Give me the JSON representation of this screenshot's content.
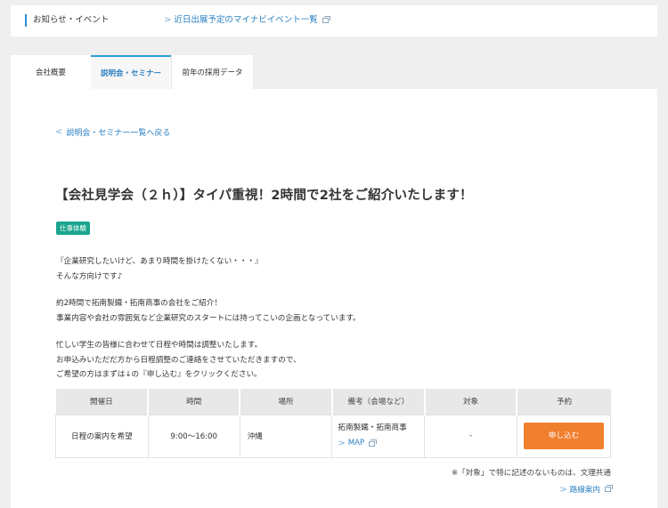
{
  "notice": {
    "label": "お知らせ・イベント",
    "link": "近日出展予定のマイナビイベント一覧"
  },
  "tabs": [
    "会社概要",
    "説明会・セミナー",
    "前年の採用データ"
  ],
  "back_link": "説明会・セミナー一覧へ戻る",
  "title": "【会社見学会（２ｈ）】タイパ重視！2時間で2社をご紹介いたします！",
  "badge": "仕事体験",
  "description": [
    "『企業研究したいけど、あまり時間を掛けたくない・・・』",
    "そんな方向けです♪",
    "約2時間で拓南製鐵・拓南商事の会社をご紹介！",
    "事業内容や会社の雰囲気など企業研究のスタートには持ってこいの企画となっています。",
    "忙しい学生の皆様に合わせて日程や時間は調整いたします。",
    "お申込みいただだ方から日程調整のご連絡をさせていただきますので、",
    "ご希望の方はまずは↓の『申し込む』をクリックください。"
  ],
  "table": {
    "headers": [
      "開催日",
      "時間",
      "場所",
      "備考（会場など）",
      "対象",
      "予約"
    ],
    "row": {
      "date": "日程の案内を希望",
      "time": "9:00〜16:00",
      "place": "沖縄",
      "note": "拓南製鐵・拓南商事",
      "map": "MAP",
      "target": "-",
      "apply": "申し込む"
    }
  },
  "footnote": "※「対象」で特に記述のないものは、文理共通",
  "access": "路線案内"
}
